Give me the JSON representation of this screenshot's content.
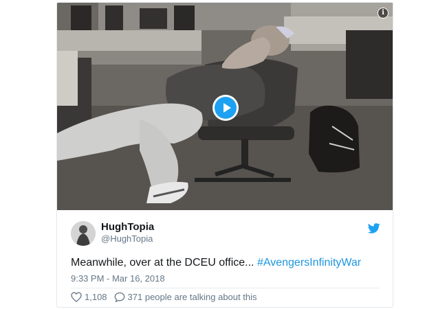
{
  "tweet": {
    "author_name": "HughTopia",
    "author_handle": "@HughTopia",
    "text_prefix": "Meanwhile, over at the DCEU office... ",
    "hashtag": "#AvengersInfinityWar",
    "timestamp": "9:33 PM - Mar 16, 2018",
    "likes": "1,108",
    "talking": "371 people are talking about this"
  },
  "media": {
    "info_label": "i",
    "description_icon": "play-icon"
  },
  "colors": {
    "accent": "#1da1f2",
    "link": "#1b95e0",
    "meta": "#657786"
  }
}
